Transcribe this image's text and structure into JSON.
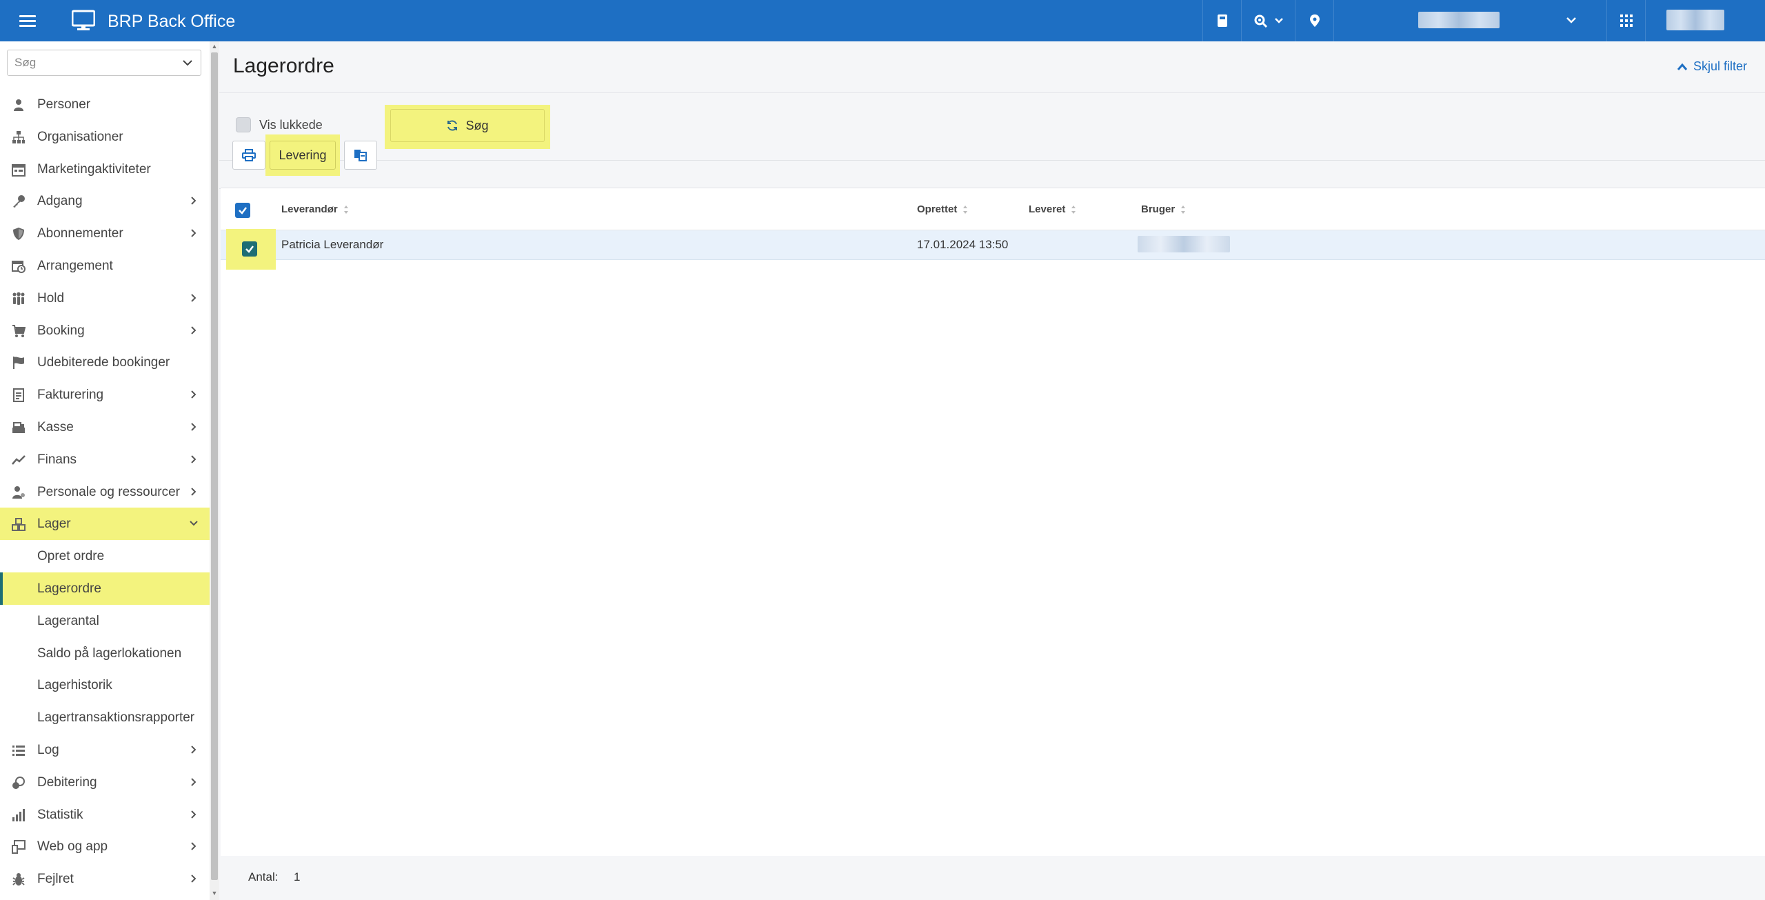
{
  "app": {
    "title": "BRP Back Office"
  },
  "sidebar": {
    "search_placeholder": "Søg",
    "items": [
      {
        "label": "Personer",
        "icon": "person-icon",
        "has_arrow": false
      },
      {
        "label": "Organisationer",
        "icon": "org-chart-icon",
        "has_arrow": false
      },
      {
        "label": "Marketingaktiviteter",
        "icon": "calendar-list-icon",
        "has_arrow": false
      },
      {
        "label": "Adgang",
        "icon": "key-icon",
        "has_arrow": true
      },
      {
        "label": "Abonnementer",
        "icon": "shield-icon",
        "has_arrow": true
      },
      {
        "label": "Arrangement",
        "icon": "calendar-clock-icon",
        "has_arrow": false
      },
      {
        "label": "Hold",
        "icon": "group-icon",
        "has_arrow": true
      },
      {
        "label": "Booking",
        "icon": "cart-icon",
        "has_arrow": true
      },
      {
        "label": "Udebiterede bookinger",
        "icon": "flag-icon",
        "has_arrow": false
      },
      {
        "label": "Fakturering",
        "icon": "invoice-icon",
        "has_arrow": true
      },
      {
        "label": "Kasse",
        "icon": "cash-register-icon",
        "has_arrow": true
      },
      {
        "label": "Finans",
        "icon": "chart-line-icon",
        "has_arrow": true
      },
      {
        "label": "Personale og ressourcer",
        "icon": "staff-icon",
        "has_arrow": true
      },
      {
        "label": "Lager",
        "icon": "boxes-icon",
        "has_arrow": true,
        "active": true
      }
    ],
    "sub_items": [
      {
        "label": "Opret ordre"
      },
      {
        "label": "Lagerordre",
        "active": true
      },
      {
        "label": "Lagerantal"
      },
      {
        "label": "Saldo på lagerlokationen"
      },
      {
        "label": "Lagerhistorik"
      },
      {
        "label": "Lagertransaktionsrapporter"
      }
    ],
    "items_after": [
      {
        "label": "Log",
        "icon": "list-icon",
        "has_arrow": true
      },
      {
        "label": "Debitering",
        "icon": "coins-icon",
        "has_arrow": true
      },
      {
        "label": "Statistik",
        "icon": "bar-chart-icon",
        "has_arrow": true
      },
      {
        "label": "Web og app",
        "icon": "web-app-icon",
        "has_arrow": true
      },
      {
        "label": "Fejlret",
        "icon": "bug-icon",
        "has_arrow": true
      }
    ]
  },
  "page": {
    "title": "Lagerordre",
    "hide_filter_label": "Skjul filter"
  },
  "filter": {
    "show_closed_label": "Vis lukkede",
    "show_closed_checked": false,
    "search_button_label": "Søg"
  },
  "toolbar": {
    "delivery_label": "Levering"
  },
  "table": {
    "columns": [
      "Leverandør",
      "Oprettet",
      "Leveret",
      "Bruger"
    ],
    "rows": [
      {
        "supplier": "Patricia Leverandør",
        "created": "17.01.2024 13:50",
        "delivered": "",
        "user": ""
      }
    ]
  },
  "footer": {
    "count_label": "Antal:",
    "count_value": "1"
  },
  "colors": {
    "topbar": "#1e6fc3",
    "highlight": "#f3f37e",
    "selected_row": "#e8f1fb",
    "link": "#1e6fc3"
  }
}
